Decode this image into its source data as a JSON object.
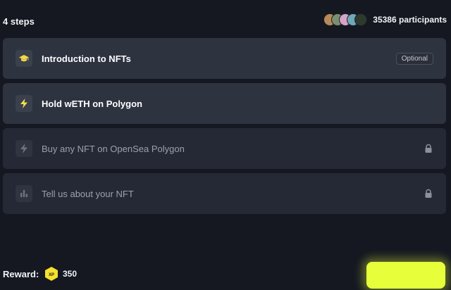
{
  "header": {
    "steps_label": "4 steps",
    "participants_label": "35386 participants",
    "avatar_colors": [
      "#b78a5a",
      "#7a8f6e",
      "#d6a2c8",
      "#6fa7b8",
      "#2c3a2c"
    ]
  },
  "tasks": [
    {
      "title": "Introduction to NFTs",
      "icon": "graduation-cap-icon",
      "badge": "Optional",
      "state": "done"
    },
    {
      "title": "Hold wETH on Polygon",
      "icon": "lightning-icon",
      "state": "done"
    },
    {
      "title": "Buy any NFT on OpenSea Polygon",
      "icon": "lightning-icon",
      "state": "locked"
    },
    {
      "title": "Tell us about your NFT",
      "icon": "bar-chart-icon",
      "state": "locked"
    }
  ],
  "footer": {
    "reward_label": "Reward:",
    "xp_badge": "XP",
    "xp_value": "350",
    "accent": "#e6ff3a"
  }
}
